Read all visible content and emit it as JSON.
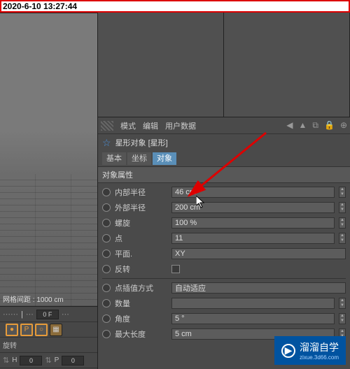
{
  "timestamp": "2020-6-10 13:27:44",
  "viewport": {
    "grid_status": "网格间距 : 1000 cm"
  },
  "timeline": {
    "fps_label": "0 F",
    "rotate_label": "旋转",
    "h_label": "H",
    "h_value": "0",
    "p_label": "P",
    "p_value": "0"
  },
  "attr_toolbar": {
    "mode": "模式",
    "edit": "编辑",
    "userdata": "用户数据"
  },
  "object": {
    "name": "星形对象 [星形]"
  },
  "tabs": {
    "basic": "基本",
    "coord": "坐标",
    "object": "对象"
  },
  "section_props": "对象属性",
  "props": {
    "inner_radius_label": "内部半径",
    "inner_radius_value": "46 cm",
    "outer_radius_label": "外部半径",
    "outer_radius_value": "200 cm",
    "twist_label": "螺旋",
    "twist_value": "100 %",
    "points_label": "点",
    "points_value": "11",
    "plane_label": "平面.",
    "plane_value": "XY",
    "reverse_label": "反转",
    "interp_label": "点插值方式",
    "interp_value": "自动适应",
    "count_label": "数量",
    "count_value": "",
    "angle_label": "角度",
    "angle_value": "5 °",
    "maxlen_label": "最大长度",
    "maxlen_value": "5 cm"
  },
  "watermark": {
    "brand": "溜溜自学",
    "url": "zixue.3d66.com"
  }
}
